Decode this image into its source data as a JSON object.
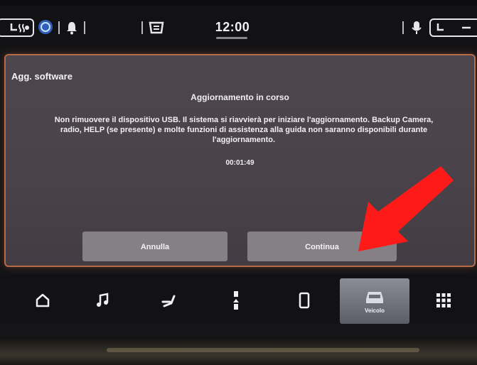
{
  "status_bar": {
    "time": "12:00"
  },
  "dialog": {
    "title": "Agg. software",
    "heading": "Aggiornamento in corso",
    "message": "Non rimuovere il dispositivo USB. Il sistema si riavvierà per iniziare l'aggiornamento. Backup Camera, radio, HELP (se presente) e molte funzioni di assistenza alla guida non saranno disponibili durante l'aggiornamento.",
    "timer": "00:01:49",
    "cancel_label": "Annulla",
    "continue_label": "Continua"
  },
  "nav_bar": {
    "selected_label": "Veicolo"
  },
  "colors": {
    "dialog_border": "#b66a45",
    "arrow": "#ff1a1a"
  }
}
